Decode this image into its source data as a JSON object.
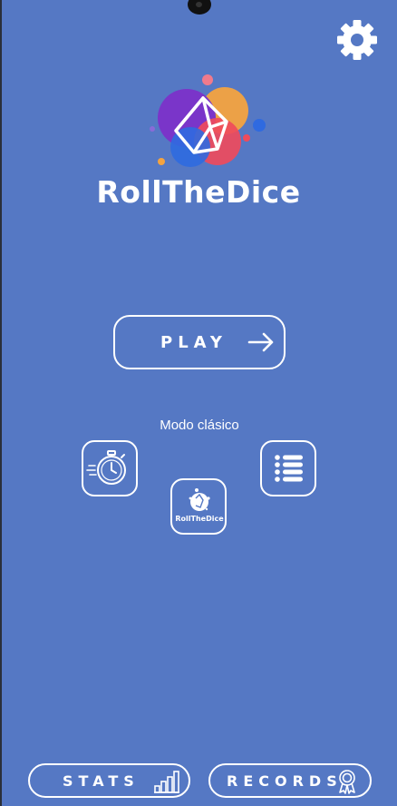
{
  "app": {
    "title": "RollTheDice",
    "logo_mini_title": "RollTheDice"
  },
  "main": {
    "play_label": "PLAY",
    "mode_label": "Modo clásico"
  },
  "modes": [
    {
      "icon": "stopwatch-icon"
    },
    {
      "icon": "dice-logo-icon"
    },
    {
      "icon": "list-icon"
    }
  ],
  "bottom": {
    "stats_label": "STATS",
    "records_label": "RECORDS"
  },
  "colors": {
    "background": "#5578c4",
    "logo_purple": "#7a35c9",
    "logo_orange": "#f4a340",
    "logo_red": "#ef4b5c",
    "logo_blue": "#2f6ae0"
  }
}
